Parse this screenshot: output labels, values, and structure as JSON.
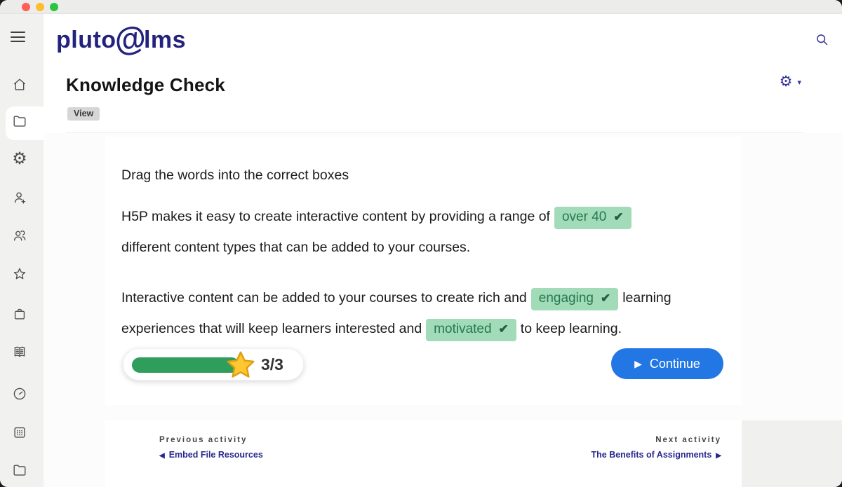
{
  "header": {
    "logo_part1": "pluto",
    "logo_at": "@",
    "logo_part2": "lms"
  },
  "icons": {
    "sidebar": [
      "home",
      "folder",
      "settings",
      "user-add",
      "users",
      "star",
      "bag",
      "book",
      "dashboard",
      "calendar",
      "folder"
    ],
    "gear_glyph": "⚙",
    "caret_down": "▾",
    "prev_arrow": "◀",
    "next_arrow": "▶",
    "play": "▶"
  },
  "page": {
    "title": "Knowledge Check",
    "view_badge": "View"
  },
  "activity": {
    "instruction": "Drag the words into the correct boxes",
    "p1_text1": "H5P makes it easy to create interactive content by providing a range of",
    "p1_answer": "over 40",
    "p1_text2": "different content types that can be added to your courses.",
    "p2_text1": "Interactive content can be added to your courses to create rich and",
    "p2_answer1": "engaging",
    "p2_text2": "learning",
    "p2_text3": "experiences that will keep learners interested and",
    "p2_answer2": "motivated",
    "p2_text4": "to keep learning.",
    "check_mark": "✔",
    "score": "3/3",
    "continue_label": "Continue"
  },
  "footer": {
    "previous_label": "Previous activity",
    "previous_link": "Embed File Resources",
    "next_label": "Next activity",
    "next_link": "The Benefits of Assignments"
  },
  "colors": {
    "brand_navy": "#23237e",
    "chip_bg": "#a2dbb7",
    "chip_text": "#267950",
    "progress_green": "#2f9e5c",
    "continue_blue": "#2277e5",
    "star_gold": "#ffc831"
  }
}
